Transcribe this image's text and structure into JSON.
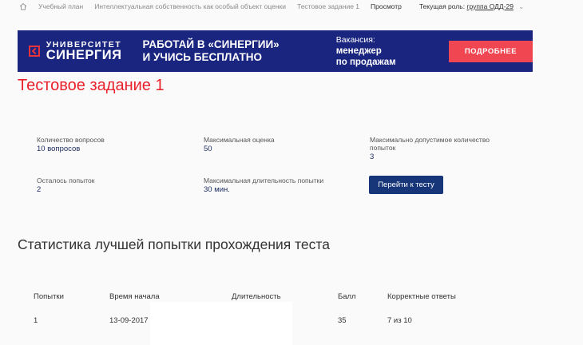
{
  "breadcrumb": {
    "items": [
      "Учебный план",
      "Интеллектуальная собственность как особый объект оценки",
      "Тестовое задание 1",
      "Просмотр"
    ],
    "role_label": "Текущая роль:",
    "role_value": "группа ОДД-29"
  },
  "banner": {
    "logo_line1": "УНИВЕРСИТЕТ",
    "logo_line2": "СИНЕРГИЯ",
    "slogan_line1": "РАБОТАЙ В «СИНЕРГИИ»",
    "slogan_line2": "И УЧИСЬ БЕСПЛАТНО",
    "vacancy_label": "Вакансия:",
    "vacancy_line1": "менеджер",
    "vacancy_line2": "по продажам",
    "button_label": "ПОДРОБНЕЕ",
    "colors": {
      "background": "#1a2580",
      "button": "#ef4651"
    }
  },
  "page_title": "Тестовое задание 1",
  "info": {
    "questions_label": "Количество вопросов",
    "questions_value": "10 вопросов",
    "max_score_label": "Максимальная оценка",
    "max_score_value": "50",
    "max_attempts_label_1": "Максимально допустимое количество",
    "max_attempts_label_2": "попыток",
    "max_attempts_value": "3",
    "attempts_left_label": "Осталось попыток",
    "attempts_left_value": "2",
    "max_duration_label": "Максимальная длительность попытки",
    "max_duration_value": "30 мин.",
    "go_button": "Перейти к тесту"
  },
  "stats": {
    "title": "Статистика лучшей попытки прохождения теста",
    "headers": [
      "Попытки",
      "Время начала",
      "Длительность",
      "Балл",
      "Корректные ответы"
    ],
    "rows": [
      [
        "1",
        "13-09-2017",
        "",
        "35",
        "7 из 10"
      ]
    ]
  }
}
